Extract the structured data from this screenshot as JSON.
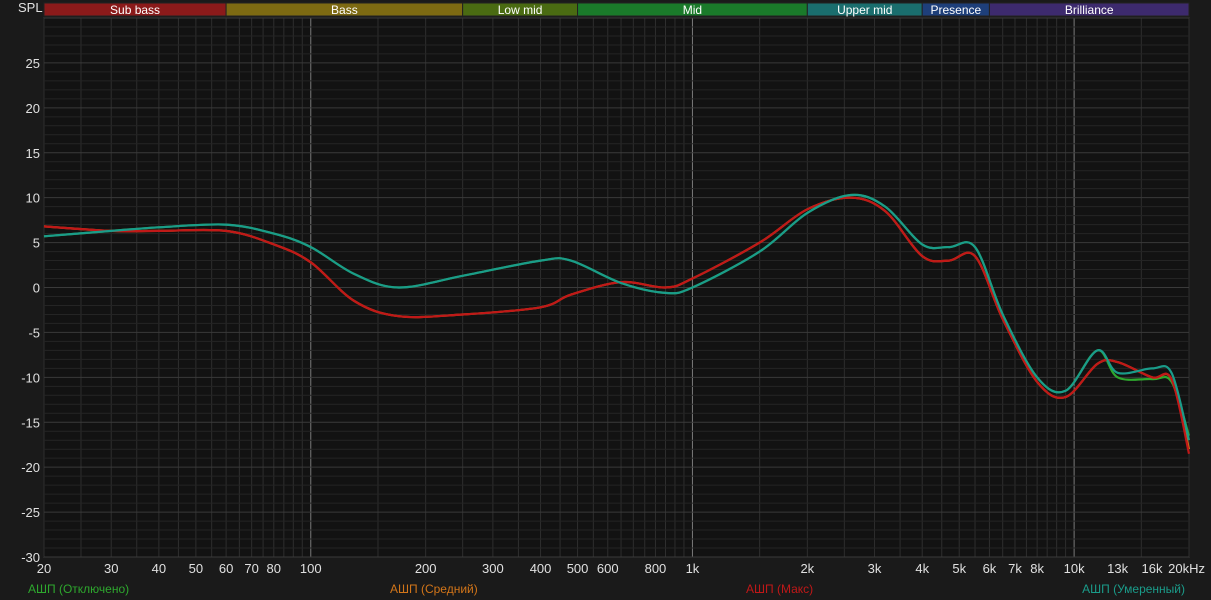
{
  "chart_data": {
    "type": "line",
    "ylabel": "SPL",
    "xlabel": "",
    "x_scale": "log",
    "xlim": [
      20,
      20000
    ],
    "ylim": [
      -30,
      30
    ],
    "grid": true,
    "x_ticks": [
      {
        "v": 20,
        "label": "20"
      },
      {
        "v": 30,
        "label": "30"
      },
      {
        "v": 40,
        "label": "40"
      },
      {
        "v": 50,
        "label": "50"
      },
      {
        "v": 60,
        "label": "60"
      },
      {
        "v": 70,
        "label": "70"
      },
      {
        "v": 80,
        "label": "80"
      },
      {
        "v": 100,
        "label": "100"
      },
      {
        "v": 200,
        "label": "200"
      },
      {
        "v": 300,
        "label": "300"
      },
      {
        "v": 400,
        "label": "400"
      },
      {
        "v": 500,
        "label": "500"
      },
      {
        "v": 600,
        "label": "600"
      },
      {
        "v": 800,
        "label": "800"
      },
      {
        "v": 1000,
        "label": "1k"
      },
      {
        "v": 2000,
        "label": "2k"
      },
      {
        "v": 3000,
        "label": "3k"
      },
      {
        "v": 4000,
        "label": "4k"
      },
      {
        "v": 5000,
        "label": "5k"
      },
      {
        "v": 6000,
        "label": "6k"
      },
      {
        "v": 7000,
        "label": "7k"
      },
      {
        "v": 8000,
        "label": "8k"
      },
      {
        "v": 10000,
        "label": "10k"
      },
      {
        "v": 13000,
        "label": "13k"
      },
      {
        "v": 16000,
        "label": "16k"
      },
      {
        "v": 20000,
        "label": "20kHz"
      }
    ],
    "y_ticks": [
      25,
      20,
      15,
      10,
      5,
      0,
      -5,
      -10,
      -15,
      -20,
      -25,
      -30
    ],
    "bands": [
      {
        "name": "Sub bass",
        "from": 20,
        "to": 60,
        "color": "#8b1a1a"
      },
      {
        "name": "Bass",
        "from": 60,
        "to": 250,
        "color": "#7d6a12"
      },
      {
        "name": "Low mid",
        "from": 250,
        "to": 500,
        "color": "#4a6b12"
      },
      {
        "name": "Mid",
        "from": 500,
        "to": 2000,
        "color": "#1a7a2a"
      },
      {
        "name": "Upper mid",
        "from": 2000,
        "to": 4000,
        "color": "#1a6e6e"
      },
      {
        "name": "Presence",
        "from": 4000,
        "to": 6000,
        "color": "#1e3f7a"
      },
      {
        "name": "Brilliance",
        "from": 6000,
        "to": 20000,
        "color": "#3d2a6e"
      }
    ],
    "series": [
      {
        "name": "АШП (Отключено)",
        "color": "#2ea82e",
        "x": [
          20,
          30,
          40,
          60,
          80,
          100,
          130,
          170,
          250,
          400,
          480,
          650,
          850,
          1000,
          1500,
          2000,
          2600,
          3200,
          4000,
          4700,
          5500,
          6500,
          8000,
          9500,
          11500,
          13000,
          16000,
          18000,
          20000
        ],
        "y": [
          5.7,
          6.3,
          6.7,
          7.0,
          6.0,
          4.5,
          1.5,
          0.0,
          1.3,
          3.0,
          3.0,
          0.5,
          -0.6,
          0.0,
          4.0,
          8.3,
          10.3,
          9.0,
          4.8,
          4.5,
          4.5,
          -3.0,
          -10.0,
          -11.5,
          -7.0,
          -10.0,
          -10.2,
          -10.5,
          -16.5
        ]
      },
      {
        "name": "АШП (Средний)",
        "color": "#d27519",
        "x": [
          20,
          30,
          40,
          60,
          80,
          100,
          130,
          170,
          250,
          400,
          480,
          650,
          850,
          1000,
          1500,
          2000,
          2600,
          3200,
          4000,
          4700,
          5500,
          6500,
          8000,
          9500,
          11500,
          13000,
          16000,
          18000,
          20000
        ],
        "y": [
          6.8,
          6.3,
          6.3,
          6.3,
          4.8,
          2.8,
          -1.5,
          -3.2,
          -3.0,
          -2.2,
          -0.8,
          0.6,
          0.0,
          1.0,
          5.0,
          8.7,
          10.0,
          8.5,
          3.5,
          3.0,
          3.5,
          -3.5,
          -10.5,
          -12.2,
          -8.5,
          -8.3,
          -10.0,
          -10.2,
          -18.0
        ]
      },
      {
        "name": "АШП (Макс)",
        "color": "#c01818",
        "x": [
          20,
          30,
          40,
          60,
          80,
          100,
          130,
          170,
          250,
          400,
          480,
          650,
          850,
          1000,
          1500,
          2000,
          2600,
          3200,
          4000,
          4700,
          5500,
          6500,
          8000,
          9500,
          11500,
          13000,
          16000,
          18000,
          20000
        ],
        "y": [
          6.8,
          6.3,
          6.3,
          6.3,
          4.8,
          2.8,
          -1.5,
          -3.2,
          -3.0,
          -2.2,
          -0.8,
          0.6,
          0.0,
          1.0,
          5.0,
          8.7,
          10.0,
          8.5,
          3.5,
          3.0,
          3.5,
          -3.5,
          -10.5,
          -12.2,
          -8.5,
          -8.3,
          -10.0,
          -10.2,
          -18.5
        ]
      },
      {
        "name": "АШП (Умеренный)",
        "color": "#1a9c8a",
        "x": [
          20,
          30,
          40,
          60,
          80,
          100,
          130,
          170,
          250,
          400,
          480,
          650,
          850,
          1000,
          1500,
          2000,
          2600,
          3200,
          4000,
          4700,
          5500,
          6500,
          8000,
          9500,
          11500,
          13000,
          16000,
          18000,
          20000
        ],
        "y": [
          5.7,
          6.3,
          6.7,
          7.0,
          6.0,
          4.5,
          1.5,
          0.0,
          1.3,
          3.0,
          3.0,
          0.5,
          -0.6,
          0.0,
          4.0,
          8.3,
          10.3,
          9.0,
          4.8,
          4.5,
          4.5,
          -3.0,
          -10.0,
          -11.5,
          -7.0,
          -9.5,
          -9.0,
          -9.5,
          -17.0
        ]
      }
    ],
    "legend_placement": "bottom"
  }
}
